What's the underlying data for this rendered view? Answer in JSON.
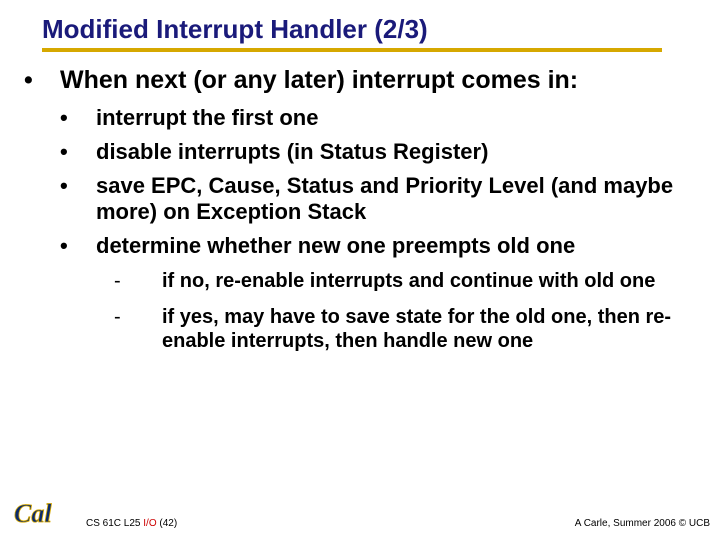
{
  "title": "Modified Interrupt Handler (2/3)",
  "main_bullet": "When next (or any later) interrupt comes in:",
  "sub_bullets": [
    "interrupt the first one",
    "disable interrupts (in Status Register)",
    "save EPC, Cause, Status and Priority Level (and maybe more) on Exception Stack",
    "determine whether new one preempts old one"
  ],
  "dash_items": [
    "if no, re-enable interrupts and continue with old one",
    "if yes, may have to save state for the old one, then re-enable interrupts, then handle new one"
  ],
  "footer": {
    "left_course": "CS 61C L25 ",
    "left_io": "I/O",
    "left_page": " (42)",
    "right": "A Carle, Summer 2006 © UCB"
  },
  "logo_text": "Cal"
}
